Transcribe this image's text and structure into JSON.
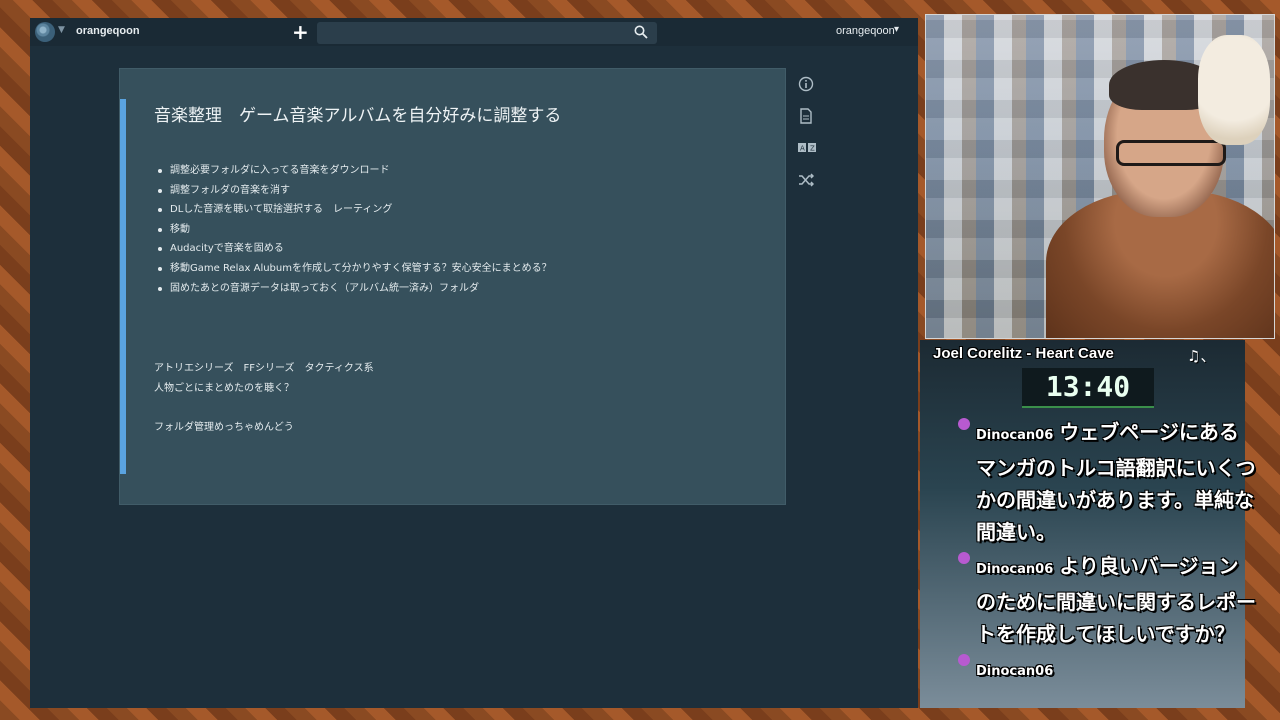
{
  "topbar": {
    "account_left": "orangeqoon",
    "account_right": "orangeqoon",
    "search_placeholder": ""
  },
  "note": {
    "title": "音楽整理　ゲーム音楽アルバムを自分好みに調整する",
    "tasks": [
      "調整必要フォルダに入ってる音楽をダウンロード",
      "調整フォルダの音楽を消す",
      "DLした音源を聴いて取捨選択する　レーティング",
      "移動",
      "Audacityで音楽を固める",
      "移動Game Relax Alubumを作成して分かりやすく保管する？安心安全にまとめる？",
      "固めたあとの音源データは取っておく（アルバム統一済み）フォルダ"
    ],
    "paragraph1": "アトリエシリーズ　FFシリーズ　タクティクス系",
    "paragraph2": "人物ごとにまとめたのを聴く？",
    "paragraph3": "フォルダ管理めっちゃめんどう"
  },
  "side_icons": [
    "info-icon",
    "document-icon",
    "translate-icon",
    "shuffle-icon"
  ],
  "stream": {
    "song": "Joel Corelitz - Heart Cave",
    "song_suffix": "♫、",
    "timer": "13:40",
    "chat": [
      {
        "user": "Dinocan06",
        "text": "ウェブページにあるマンガのトルコ語翻訳にいくつかの間違いがあります。単純な間違い。"
      },
      {
        "user": "Dinocan06",
        "text": "より良いバージョンのために間違いに関するレポートを作成してほしいですか？"
      },
      {
        "user": "Dinocan06",
        "text": ""
      }
    ]
  },
  "colors": {
    "app_bg": "#1d2f3b",
    "note_bg": "#36505c",
    "accent_rule": "#5aa3e0",
    "badge": "#b75ad0"
  }
}
